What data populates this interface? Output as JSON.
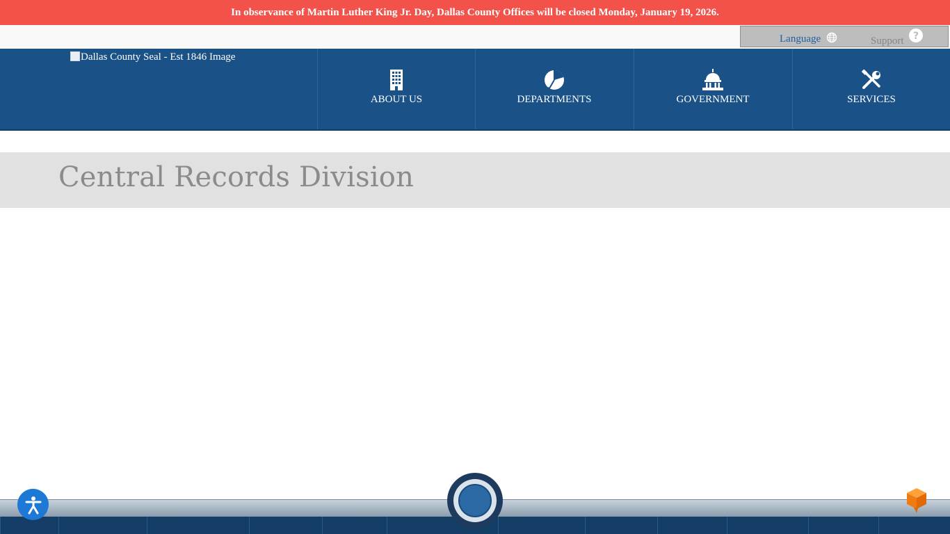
{
  "alert": {
    "text": "In observance of Martin Luther King Jr. Day, Dallas County Offices will be closed Monday, January 19, 2026."
  },
  "utility": {
    "language_label": "Language",
    "support_label": "Support"
  },
  "header": {
    "logo_alt": "Dallas County Seal - Est 1846 Image",
    "nav": [
      {
        "label": "ABOUT US",
        "icon": "building-icon"
      },
      {
        "label": "DEPARTMENTS",
        "icon": "pie-chart-icon"
      },
      {
        "label": "GOVERNMENT",
        "icon": "capitol-icon"
      },
      {
        "label": "SERVICES",
        "icon": "tools-icon"
      }
    ]
  },
  "page": {
    "title": "Central Records Division"
  },
  "colors": {
    "alert_bg": "#f2524a",
    "header_bg": "#1a5186",
    "title_band_bg": "#e1e1e1",
    "language_link": "#1f5f9e"
  },
  "widgets": {
    "accessibility_icon": "accessibility-icon",
    "center_icon": "circle-button-icon",
    "chat_icon": "chat-cube-icon"
  }
}
